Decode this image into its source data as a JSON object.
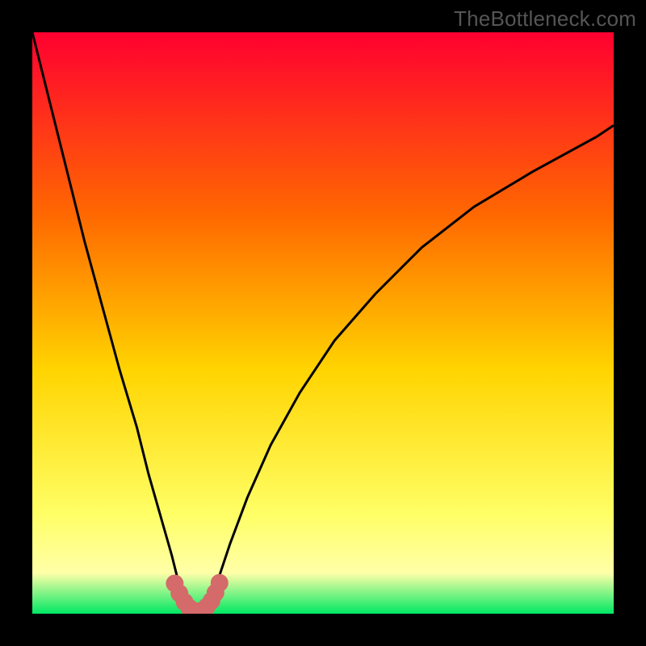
{
  "watermark": "TheBottleneck.com",
  "colors": {
    "frame": "#000000",
    "gradient_top": "#ff0030",
    "gradient_mid1": "#ff6a00",
    "gradient_mid2": "#ffd400",
    "gradient_mid3": "#ffff66",
    "gradient_bottom": "#00e863",
    "curve": "#000000",
    "marker": "#d46a6a"
  },
  "chart_data": {
    "type": "line",
    "title": "",
    "xlabel": "",
    "ylabel": "",
    "xlim": [
      0,
      100
    ],
    "ylim": [
      0,
      100
    ],
    "series": [
      {
        "name": "bottleneck-curve",
        "x": [
          0,
          3,
          6,
          9,
          12,
          15,
          18,
          20,
          22,
          24,
          25,
          26,
          27,
          28,
          29,
          30,
          31,
          32,
          34,
          37,
          41,
          46,
          52,
          59,
          67,
          76,
          86,
          97,
          100
        ],
        "values": [
          100,
          88,
          76,
          64,
          53,
          42,
          32,
          24,
          17,
          10,
          6,
          3,
          1,
          0,
          0,
          1,
          3,
          6,
          12,
          20,
          29,
          38,
          47,
          55,
          63,
          70,
          76,
          82,
          84
        ]
      }
    ],
    "markers": {
      "name": "minimum-band",
      "x": [
        24.5,
        25.3,
        26.2,
        27.0,
        27.8,
        28.5,
        29.3,
        30.0,
        30.8,
        31.5,
        32.2
      ],
      "values": [
        5.2,
        3.5,
        2.0,
        1.0,
        0.5,
        0.3,
        0.6,
        1.2,
        2.2,
        3.6,
        5.3
      ]
    },
    "legend": false,
    "grid": false
  }
}
